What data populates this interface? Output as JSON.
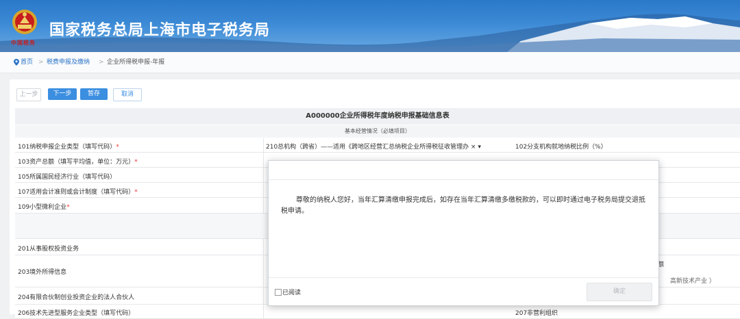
{
  "header": {
    "site_title": "国家税务总局上海市电子税务局",
    "brand_sub": "中国税务"
  },
  "breadcrumb": {
    "home": "首页",
    "sep": ">",
    "link": "税费申报及缴纳",
    "current": "企业所得税申报-年报"
  },
  "toolbar": {
    "prev": "上一步",
    "next": "下一步",
    "save": "暂存",
    "cancel": "取消"
  },
  "form": {
    "title": "A000000企业所得税年度纳税申报基础信息表",
    "section": "基本经营情况（必填项目）",
    "rows": [
      {
        "label": "101纳税申报企业类型（填写代码）",
        "required": "*",
        "value": "210总机构（跨省）——适用《跨地区经营汇总纳税企业所得税征收管理办 ×  ▾",
        "right": "102分支机构就地纳税比例（%）"
      },
      {
        "label": "103资产总额（填写平均值，单位：万元）",
        "required": "*",
        "value": "",
        "right": ""
      },
      {
        "label": "105所属国民经济行业（填写代码）",
        "required": "",
        "value": "",
        "right": ""
      },
      {
        "label": "107适用会计准则或会计制度（填写代码）",
        "required": "*",
        "value": "",
        "right": ""
      },
      {
        "label": "109小型微利企业",
        "required": "*",
        "value": "",
        "right": ""
      },
      {
        "label": "201从事股权投资业务",
        "required": "",
        "value": "",
        "right": ""
      },
      {
        "label": "203境外所得信息",
        "required": "",
        "value": "",
        "right": ""
      },
      {
        "label": "204有限合伙制创业投资企业的法人合伙人",
        "required": "",
        "value": "",
        "right": ""
      },
      {
        "label": "206技术先进型服务企业类型（填写代码）",
        "required": "",
        "value": "",
        "right": "207非营利组织"
      }
    ],
    "peek_right_1": "额",
    "peek_right_2": "高新技术产业 ）"
  },
  "dialog": {
    "message": "尊敬的纳税人您好，当年汇算清缴申报完成后，如存在当年汇算清缴多缴税款的，可以即时通过电子税务局提交退抵税申请。",
    "checkbox_label": "已阅读",
    "ok_label": "确定"
  }
}
